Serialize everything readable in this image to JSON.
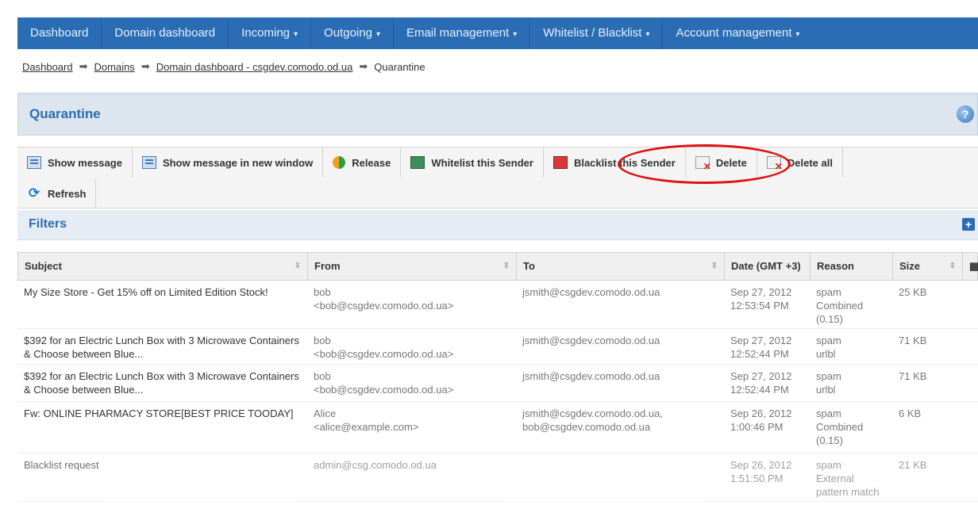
{
  "nav": {
    "items": [
      {
        "label": "Dashboard",
        "caret": ""
      },
      {
        "label": "Domain dashboard",
        "caret": ""
      },
      {
        "label": "Incoming",
        "caret": "▾"
      },
      {
        "label": "Outgoing",
        "caret": "▾"
      },
      {
        "label": "Email management",
        "caret": "▾"
      },
      {
        "label": "Whitelist / Blacklist",
        "caret": "▾"
      },
      {
        "label": "Account management",
        "caret": "▾"
      }
    ]
  },
  "breadcrumb": {
    "items": [
      "Dashboard",
      "Domains",
      "Domain dashboard - csgdev.comodo.od.ua"
    ],
    "current": "Quarantine"
  },
  "panel": {
    "title": "Quarantine",
    "help": "?"
  },
  "toolbar": {
    "show_message": "Show message",
    "show_message_new_window": "Show message in new window",
    "release": "Release",
    "whitelist_sender": "Whitelist this Sender",
    "blacklist_sender": "Blacklist this Sender",
    "delete": "Delete",
    "delete_all": "Delete all",
    "refresh": "Refresh"
  },
  "filters": {
    "label": "Filters",
    "expand": "+"
  },
  "table": {
    "headers": {
      "subject": "Subject",
      "from": "From",
      "to": "To",
      "date": "Date (GMT +3)",
      "reason": "Reason",
      "size": "Size"
    },
    "sort_glyph": "⇕",
    "rows": [
      {
        "subject": "My Size Store - Get 15% off on Limited Edition Stock!",
        "from1": "bob",
        "from2": "<bob@csgdev.comodo.od.ua>",
        "to1": "jsmith@csgdev.comodo.od.ua",
        "to2": "",
        "date1": "Sep 27, 2012",
        "date2": "12:53:54 PM",
        "reason1": "spam",
        "reason2": "Combined",
        "reason3": "(0.15)",
        "size": "25 KB"
      },
      {
        "subject": "$392 for an Electric Lunch Box with 3 Microwave Containers & Choose between Blue...",
        "from1": "bob",
        "from2": "<bob@csgdev.comodo.od.ua>",
        "to1": "jsmith@csgdev.comodo.od.ua",
        "to2": "",
        "date1": "Sep 27, 2012",
        "date2": "12:52:44 PM",
        "reason1": "spam",
        "reason2": "urlbl",
        "reason3": "",
        "size": "71 KB"
      },
      {
        "subject": "$392 for an Electric Lunch Box with 3 Microwave Containers & Choose between Blue...",
        "from1": "bob",
        "from2": "<bob@csgdev.comodo.od.ua>",
        "to1": "jsmith@csgdev.comodo.od.ua",
        "to2": "",
        "date1": "Sep 27, 2012",
        "date2": "12:52:44 PM",
        "reason1": "spam",
        "reason2": "urlbl",
        "reason3": "",
        "size": "71 KB"
      },
      {
        "subject": "Fw: ONLINE PHARMACY STORE[BEST PRICE TOODAY]",
        "from1": "Alice",
        "from2": "<alice@example.com>",
        "to1": "jsmith@csgdev.comodo.od.ua,",
        "to2": "bob@csgdev.comodo.od.ua",
        "date1": "Sep 26, 2012",
        "date2": "1:00:46 PM",
        "reason1": "spam",
        "reason2": "Combined",
        "reason3": "(0.15)",
        "size": "6 KB"
      },
      {
        "subject": "Blacklist request",
        "from1": "admin@csg.comodo.od.ua",
        "from2": "",
        "to1": "",
        "to2": "",
        "date1": "Sep 26, 2012",
        "date2": "1:51:50 PM",
        "reason1": "spam",
        "reason2": "External",
        "reason3": "pattern match",
        "size": "21 KB"
      }
    ]
  }
}
